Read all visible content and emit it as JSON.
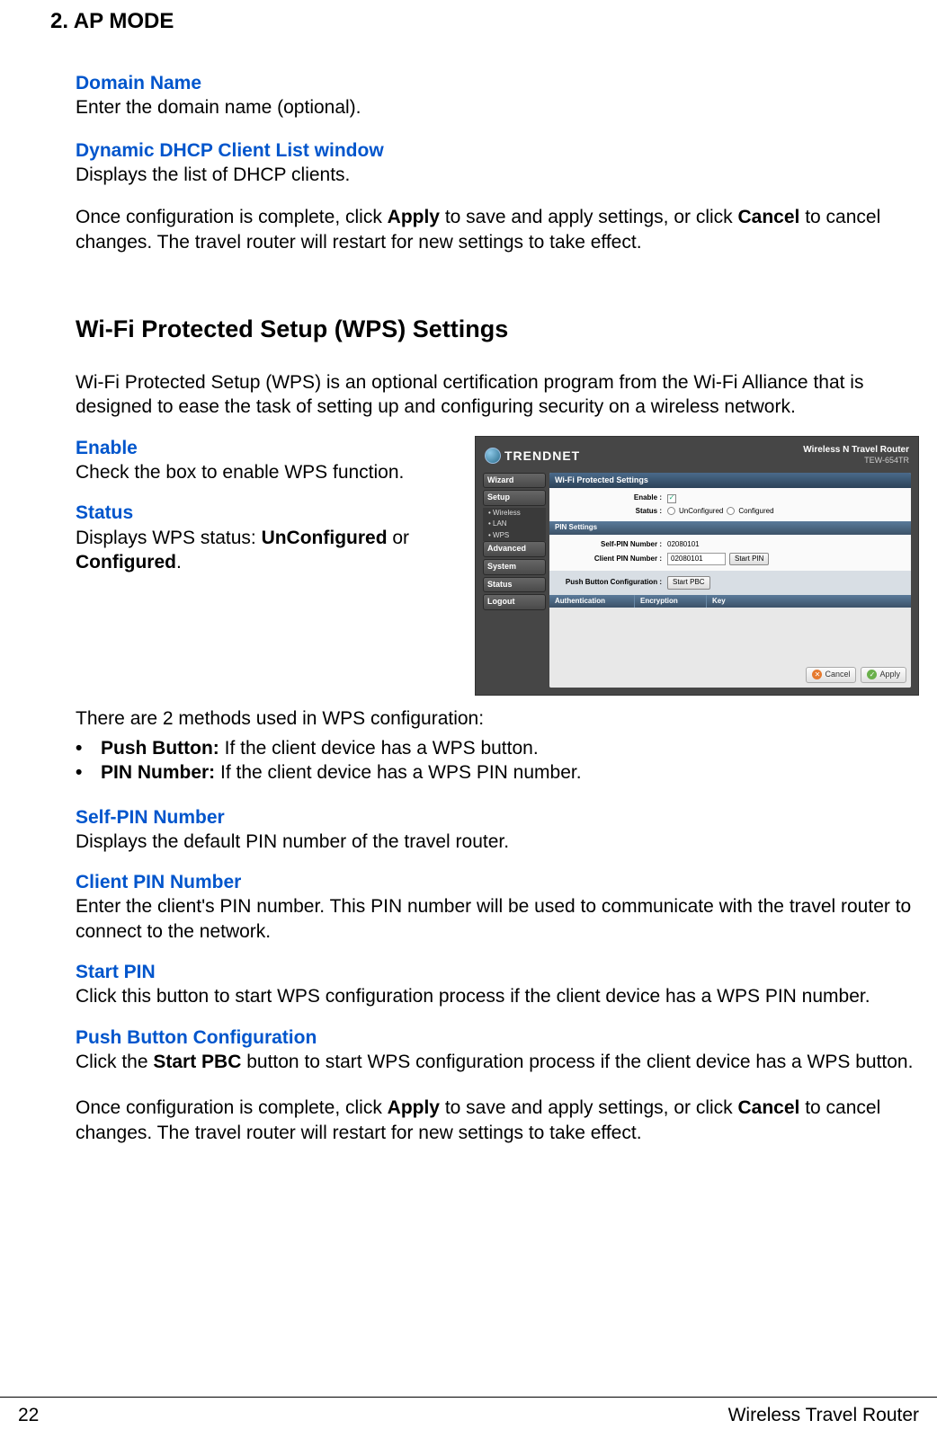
{
  "chapter": "2.  AP MODE",
  "domainName": {
    "label": "Domain Name",
    "desc": "Enter the domain name (optional)."
  },
  "dhcpList": {
    "label": "Dynamic DHCP Client List window",
    "desc": "Displays the list of DHCP clients."
  },
  "applyNote1": {
    "pre1": "Once configuration is complete, click ",
    "b1": "Apply",
    "mid": " to save and apply settings, or click ",
    "b2": "Cancel",
    "post": " to cancel changes. The travel router will restart for new settings to take effect."
  },
  "wps": {
    "heading": "Wi-Fi Protected Setup (WPS) Settings",
    "intro": "Wi-Fi Protected Setup (WPS) is an optional certification program from the Wi-Fi Alliance that is designed to ease the task of setting up and configuring security on a wireless network.",
    "enable": {
      "label": "Enable",
      "desc": "Check the box to enable WPS function."
    },
    "status": {
      "label": "Status",
      "descPre": "Displays WPS status: ",
      "b1": "UnConfigured",
      "mid": " or ",
      "b2": "Configured",
      "post": "."
    },
    "methodsIntro": "There are 2 methods used in WPS configuration:",
    "methods": [
      {
        "label": "Push Button:",
        "desc": " If the client device has a WPS button."
      },
      {
        "label": "PIN Number:",
        "desc": " If the client device has a WPS PIN number."
      }
    ],
    "selfPin": {
      "label": "Self-PIN Number",
      "desc": "Displays the default PIN number of the travel router."
    },
    "clientPin": {
      "label": "Client PIN Number",
      "desc": "Enter the client's PIN number. This PIN number will be used to communicate with the travel router to connect to the network."
    },
    "startPin": {
      "label": "Start PIN",
      "desc": "Click this button to start WPS configuration process if the client device has a WPS PIN number."
    },
    "pbc": {
      "label": "Push Button Configuration",
      "pre": "Click the ",
      "b": "Start PBC",
      "post": " button to start WPS configuration process if the client device has a WPS button."
    }
  },
  "applyNote2": {
    "pre1": "Once configuration is complete, click ",
    "b1": "Apply",
    "mid": " to save and apply settings, or click ",
    "b2": "Cancel",
    "post": " to cancel changes. The travel router will restart for new settings to take effect."
  },
  "screenshot": {
    "brand": "TRENDNET",
    "title": "Wireless N Travel Router",
    "model": "TEW-654TR",
    "nav": {
      "wizard": "Wizard",
      "setup": "Setup",
      "sub1": "• Wireless",
      "sub2": "• LAN",
      "sub3": "• WPS",
      "advanced": "Advanced",
      "system": "System",
      "status": "Status",
      "logout": "Logout"
    },
    "panelTitle": "Wi-Fi Protected Settings",
    "rowEnable": "Enable :",
    "rowStatus": "Status :",
    "radioUn": "UnConfigured",
    "radioCfg": "Configured",
    "pinHeader": "PIN Settings",
    "rowSelfPin": "Self-PIN Number :",
    "selfPinVal": "02080101",
    "rowClientPin": "Client PIN Number :",
    "clientPinVal": "02080101",
    "startPinBtn": "Start PIN",
    "rowPbc": "Push Button Configuration :",
    "startPbcBtn": "Start PBC",
    "thAuth": "Authentication",
    "thEnc": "Encryption",
    "thKey": "Key",
    "cancelBtn": "Cancel",
    "applyBtn": "Apply"
  },
  "footer": {
    "page": "22",
    "title": "Wireless Travel Router"
  }
}
